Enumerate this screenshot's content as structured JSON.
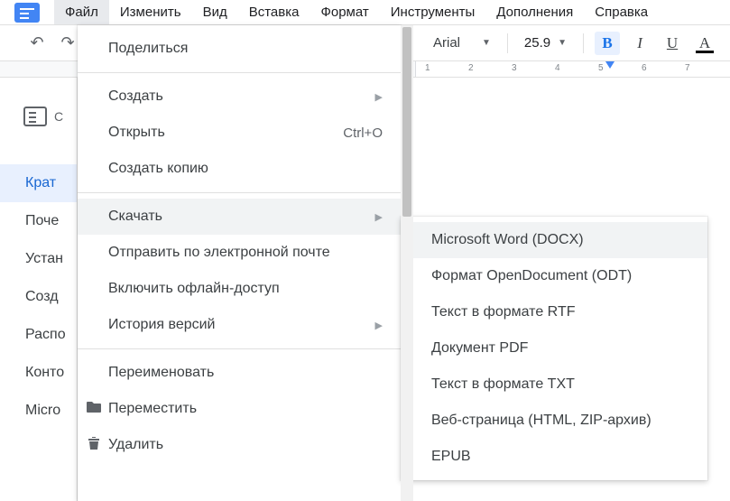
{
  "menubar": {
    "items": [
      "Файл",
      "Изменить",
      "Вид",
      "Вставка",
      "Формат",
      "Инструменты",
      "Дополнения",
      "Справка"
    ],
    "active_index": 0
  },
  "toolbar": {
    "font_name": "Arial",
    "font_size": "25.9",
    "bold_label": "B",
    "italic_label": "I",
    "underline_label": "U"
  },
  "ruler": {
    "ticks": [
      "1",
      "2",
      "3",
      "4",
      "5",
      "6",
      "7"
    ]
  },
  "outline": {
    "toggle_label": "С",
    "items": [
      "Крат",
      "Поче",
      "Устан",
      "Созд",
      "Распо",
      "Конто",
      "Micro"
    ],
    "active_index": 0
  },
  "file_menu": {
    "share": "Поделиться",
    "create": "Создать",
    "open": "Открыть",
    "open_hint": "Ctrl+O",
    "make_copy": "Создать копию",
    "download": "Скачать",
    "email": "Отправить по электронной почте",
    "offline": "Включить офлайн-доступ",
    "history": "История версий",
    "rename": "Переименовать",
    "move": "Переместить",
    "delete": "Удалить"
  },
  "download_submenu": {
    "items": [
      "Microsoft Word (DOCX)",
      "Формат OpenDocument (ODT)",
      "Текст в формате RTF",
      "Документ PDF",
      "Текст в формате TXT",
      "Веб-страница (HTML, ZIP-архив)",
      "EPUB"
    ],
    "highlight_index": 0
  }
}
